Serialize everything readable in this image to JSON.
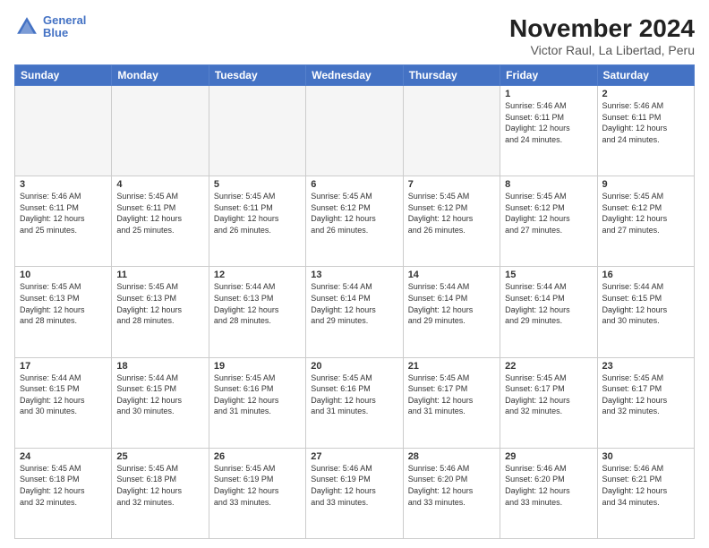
{
  "header": {
    "logo_line1": "General",
    "logo_line2": "Blue",
    "main_title": "November 2024",
    "subtitle": "Victor Raul, La Libertad, Peru"
  },
  "weekdays": [
    "Sunday",
    "Monday",
    "Tuesday",
    "Wednesday",
    "Thursday",
    "Friday",
    "Saturday"
  ],
  "weeks": [
    [
      {
        "day": "",
        "detail": ""
      },
      {
        "day": "",
        "detail": ""
      },
      {
        "day": "",
        "detail": ""
      },
      {
        "day": "",
        "detail": ""
      },
      {
        "day": "",
        "detail": ""
      },
      {
        "day": "1",
        "detail": "Sunrise: 5:46 AM\nSunset: 6:11 PM\nDaylight: 12 hours\nand 24 minutes."
      },
      {
        "day": "2",
        "detail": "Sunrise: 5:46 AM\nSunset: 6:11 PM\nDaylight: 12 hours\nand 24 minutes."
      }
    ],
    [
      {
        "day": "3",
        "detail": "Sunrise: 5:46 AM\nSunset: 6:11 PM\nDaylight: 12 hours\nand 25 minutes."
      },
      {
        "day": "4",
        "detail": "Sunrise: 5:45 AM\nSunset: 6:11 PM\nDaylight: 12 hours\nand 25 minutes."
      },
      {
        "day": "5",
        "detail": "Sunrise: 5:45 AM\nSunset: 6:11 PM\nDaylight: 12 hours\nand 26 minutes."
      },
      {
        "day": "6",
        "detail": "Sunrise: 5:45 AM\nSunset: 6:12 PM\nDaylight: 12 hours\nand 26 minutes."
      },
      {
        "day": "7",
        "detail": "Sunrise: 5:45 AM\nSunset: 6:12 PM\nDaylight: 12 hours\nand 26 minutes."
      },
      {
        "day": "8",
        "detail": "Sunrise: 5:45 AM\nSunset: 6:12 PM\nDaylight: 12 hours\nand 27 minutes."
      },
      {
        "day": "9",
        "detail": "Sunrise: 5:45 AM\nSunset: 6:12 PM\nDaylight: 12 hours\nand 27 minutes."
      }
    ],
    [
      {
        "day": "10",
        "detail": "Sunrise: 5:45 AM\nSunset: 6:13 PM\nDaylight: 12 hours\nand 28 minutes."
      },
      {
        "day": "11",
        "detail": "Sunrise: 5:45 AM\nSunset: 6:13 PM\nDaylight: 12 hours\nand 28 minutes."
      },
      {
        "day": "12",
        "detail": "Sunrise: 5:44 AM\nSunset: 6:13 PM\nDaylight: 12 hours\nand 28 minutes."
      },
      {
        "day": "13",
        "detail": "Sunrise: 5:44 AM\nSunset: 6:14 PM\nDaylight: 12 hours\nand 29 minutes."
      },
      {
        "day": "14",
        "detail": "Sunrise: 5:44 AM\nSunset: 6:14 PM\nDaylight: 12 hours\nand 29 minutes."
      },
      {
        "day": "15",
        "detail": "Sunrise: 5:44 AM\nSunset: 6:14 PM\nDaylight: 12 hours\nand 29 minutes."
      },
      {
        "day": "16",
        "detail": "Sunrise: 5:44 AM\nSunset: 6:15 PM\nDaylight: 12 hours\nand 30 minutes."
      }
    ],
    [
      {
        "day": "17",
        "detail": "Sunrise: 5:44 AM\nSunset: 6:15 PM\nDaylight: 12 hours\nand 30 minutes."
      },
      {
        "day": "18",
        "detail": "Sunrise: 5:44 AM\nSunset: 6:15 PM\nDaylight: 12 hours\nand 30 minutes."
      },
      {
        "day": "19",
        "detail": "Sunrise: 5:45 AM\nSunset: 6:16 PM\nDaylight: 12 hours\nand 31 minutes."
      },
      {
        "day": "20",
        "detail": "Sunrise: 5:45 AM\nSunset: 6:16 PM\nDaylight: 12 hours\nand 31 minutes."
      },
      {
        "day": "21",
        "detail": "Sunrise: 5:45 AM\nSunset: 6:17 PM\nDaylight: 12 hours\nand 31 minutes."
      },
      {
        "day": "22",
        "detail": "Sunrise: 5:45 AM\nSunset: 6:17 PM\nDaylight: 12 hours\nand 32 minutes."
      },
      {
        "day": "23",
        "detail": "Sunrise: 5:45 AM\nSunset: 6:17 PM\nDaylight: 12 hours\nand 32 minutes."
      }
    ],
    [
      {
        "day": "24",
        "detail": "Sunrise: 5:45 AM\nSunset: 6:18 PM\nDaylight: 12 hours\nand 32 minutes."
      },
      {
        "day": "25",
        "detail": "Sunrise: 5:45 AM\nSunset: 6:18 PM\nDaylight: 12 hours\nand 32 minutes."
      },
      {
        "day": "26",
        "detail": "Sunrise: 5:45 AM\nSunset: 6:19 PM\nDaylight: 12 hours\nand 33 minutes."
      },
      {
        "day": "27",
        "detail": "Sunrise: 5:46 AM\nSunset: 6:19 PM\nDaylight: 12 hours\nand 33 minutes."
      },
      {
        "day": "28",
        "detail": "Sunrise: 5:46 AM\nSunset: 6:20 PM\nDaylight: 12 hours\nand 33 minutes."
      },
      {
        "day": "29",
        "detail": "Sunrise: 5:46 AM\nSunset: 6:20 PM\nDaylight: 12 hours\nand 33 minutes."
      },
      {
        "day": "30",
        "detail": "Sunrise: 5:46 AM\nSunset: 6:21 PM\nDaylight: 12 hours\nand 34 minutes."
      }
    ]
  ]
}
